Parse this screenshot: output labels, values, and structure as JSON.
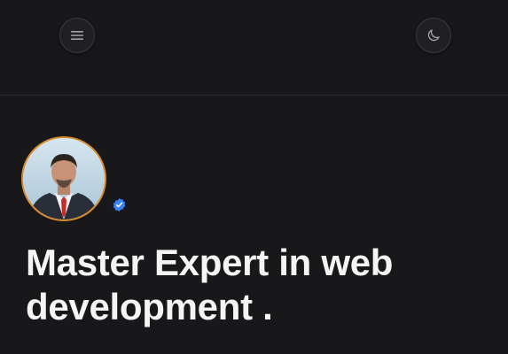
{
  "header": {
    "menu_icon": "menu-icon",
    "theme_icon": "moon-icon"
  },
  "profile": {
    "verified_icon": "verified-badge-icon",
    "avatar_border_color": "#d98a2b",
    "verified_color": "#3b82f6"
  },
  "hero": {
    "headline": "Master Expert in web development ."
  }
}
